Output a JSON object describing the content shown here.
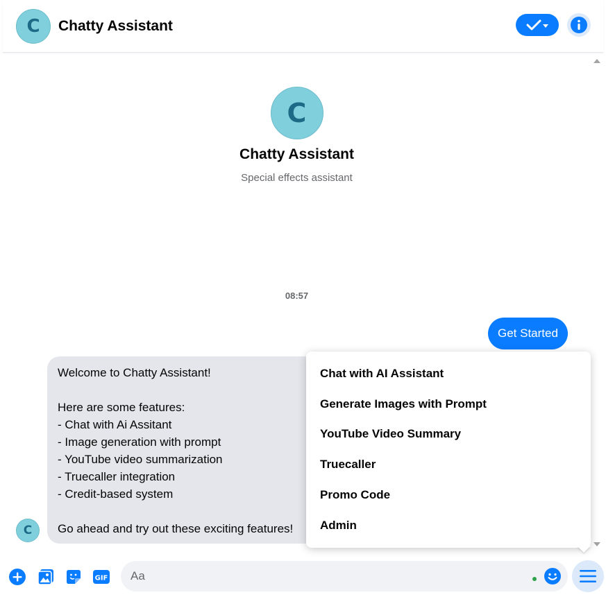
{
  "header": {
    "avatar_letter": "C",
    "title": "Chatty Assistant"
  },
  "profile": {
    "avatar_letter": "C",
    "name": "Chatty Assistant",
    "subtitle": "Special effects assistant"
  },
  "timestamp": "08:57",
  "messages": {
    "outgoing": "Get Started",
    "incoming": "Welcome to Chatty Assistant!\n\nHere are some features:\n- Chat with Ai Assitant\n- Image generation with prompt\n- YouTube video summarization\n- Truecaller integration\n- Credit-based system\n\nGo ahead and try out these exciting features!",
    "incoming_avatar_letter": "C"
  },
  "menu": {
    "items": [
      "Chat with AI Assistant",
      "Generate Images with Prompt",
      "YouTube Video Summary",
      "Truecaller",
      "Promo Code",
      "Admin"
    ]
  },
  "composer": {
    "placeholder": "Aa",
    "gif_label": "GIF"
  },
  "colors": {
    "accent": "#0a7cff",
    "avatar_bg": "#7fcfdd",
    "bubble_in": "#e4e6eb"
  }
}
